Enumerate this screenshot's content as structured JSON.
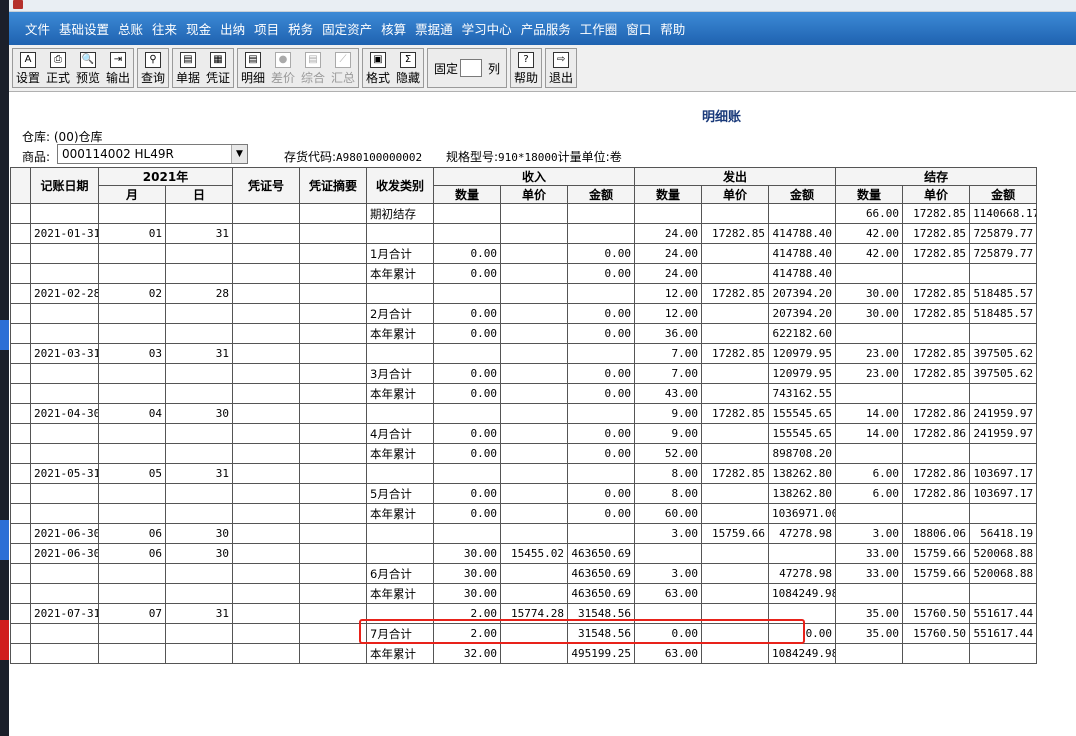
{
  "menu": [
    "文件",
    "基础设置",
    "总账",
    "往来",
    "现金",
    "出纳",
    "项目",
    "税务",
    "固定资产",
    "核算",
    "票据通",
    "学习中心",
    "产品服务",
    "工作圈",
    "窗口",
    "帮助"
  ],
  "toolbar": {
    "groups": [
      [
        {
          "label": "设置",
          "icon": "A"
        },
        {
          "label": "正式",
          "icon": "⎙"
        },
        {
          "label": "预览",
          "icon": "🔍"
        },
        {
          "label": "输出",
          "icon": "⇥"
        }
      ],
      [
        {
          "label": "查询",
          "icon": "⚲"
        }
      ],
      [
        {
          "label": "单据",
          "icon": "▤"
        },
        {
          "label": "凭证",
          "icon": "▦"
        }
      ],
      [
        {
          "label": "明细",
          "icon": "▤"
        },
        {
          "label": "差价",
          "icon": "●",
          "disabled": true
        },
        {
          "label": "综合",
          "icon": "▤",
          "disabled": true
        },
        {
          "label": "汇总",
          "icon": "⟋",
          "disabled": true
        }
      ],
      [
        {
          "label": "格式",
          "icon": "▣"
        },
        {
          "label": "隐藏",
          "icon": "Σ"
        }
      ]
    ],
    "fixed_label": "固定",
    "column_label": "列",
    "help": {
      "label": "帮助",
      "icon": "?"
    },
    "exit": {
      "label": "退出",
      "icon": "⇨"
    }
  },
  "report": {
    "title": "明细账",
    "warehouse_label": "仓库:",
    "warehouse_value": "(00)仓库",
    "goods_label": "商品:",
    "goods_value": "000114002 HL49R",
    "stock_code_label": "存货代码:",
    "stock_code_value": "A980100000002",
    "spec_label": "规格型号:",
    "spec_value": "910*18000",
    "unit_label": "计量单位:",
    "unit_value": "卷"
  },
  "table": {
    "headers": {
      "date": "记账日期",
      "year": "2021年",
      "month": "月",
      "day": "日",
      "voucher_no": "凭证号",
      "voucher_summary": "凭证摘要",
      "category": "收发类别",
      "in": "收入",
      "out": "发出",
      "balance": "结存",
      "qty": "数量",
      "price": "单价",
      "amount": "金额"
    },
    "rows": [
      {
        "date": "",
        "m": "",
        "d": "",
        "cat": "期初结存",
        "in_q": "",
        "in_p": "",
        "in_a": "",
        "out_q": "",
        "out_p": "",
        "out_a": "",
        "b_q": "66.00",
        "b_p": "17282.85",
        "b_a": "1140668.17"
      },
      {
        "date": "2021-01-31",
        "m": "01",
        "d": "31",
        "cat": "",
        "in_q": "",
        "in_p": "",
        "in_a": "",
        "out_q": "24.00",
        "out_p": "17282.85",
        "out_a": "414788.40",
        "b_q": "42.00",
        "b_p": "17282.85",
        "b_a": "725879.77"
      },
      {
        "date": "",
        "m": "",
        "d": "",
        "cat": "1月合计",
        "in_q": "0.00",
        "in_p": "",
        "in_a": "0.00",
        "out_q": "24.00",
        "out_p": "",
        "out_a": "414788.40",
        "b_q": "42.00",
        "b_p": "17282.85",
        "b_a": "725879.77"
      },
      {
        "date": "",
        "m": "",
        "d": "",
        "cat": "本年累计",
        "in_q": "0.00",
        "in_p": "",
        "in_a": "0.00",
        "out_q": "24.00",
        "out_p": "",
        "out_a": "414788.40",
        "b_q": "",
        "b_p": "",
        "b_a": ""
      },
      {
        "date": "2021-02-28",
        "m": "02",
        "d": "28",
        "cat": "",
        "in_q": "",
        "in_p": "",
        "in_a": "",
        "out_q": "12.00",
        "out_p": "17282.85",
        "out_a": "207394.20",
        "b_q": "30.00",
        "b_p": "17282.85",
        "b_a": "518485.57"
      },
      {
        "date": "",
        "m": "",
        "d": "",
        "cat": "2月合计",
        "in_q": "0.00",
        "in_p": "",
        "in_a": "0.00",
        "out_q": "12.00",
        "out_p": "",
        "out_a": "207394.20",
        "b_q": "30.00",
        "b_p": "17282.85",
        "b_a": "518485.57"
      },
      {
        "date": "",
        "m": "",
        "d": "",
        "cat": "本年累计",
        "in_q": "0.00",
        "in_p": "",
        "in_a": "0.00",
        "out_q": "36.00",
        "out_p": "",
        "out_a": "622182.60",
        "b_q": "",
        "b_p": "",
        "b_a": ""
      },
      {
        "date": "2021-03-31",
        "m": "03",
        "d": "31",
        "cat": "",
        "in_q": "",
        "in_p": "",
        "in_a": "",
        "out_q": "7.00",
        "out_p": "17282.85",
        "out_a": "120979.95",
        "b_q": "23.00",
        "b_p": "17282.85",
        "b_a": "397505.62"
      },
      {
        "date": "",
        "m": "",
        "d": "",
        "cat": "3月合计",
        "in_q": "0.00",
        "in_p": "",
        "in_a": "0.00",
        "out_q": "7.00",
        "out_p": "",
        "out_a": "120979.95",
        "b_q": "23.00",
        "b_p": "17282.85",
        "b_a": "397505.62"
      },
      {
        "date": "",
        "m": "",
        "d": "",
        "cat": "本年累计",
        "in_q": "0.00",
        "in_p": "",
        "in_a": "0.00",
        "out_q": "43.00",
        "out_p": "",
        "out_a": "743162.55",
        "b_q": "",
        "b_p": "",
        "b_a": ""
      },
      {
        "date": "2021-04-30",
        "m": "04",
        "d": "30",
        "cat": "",
        "in_q": "",
        "in_p": "",
        "in_a": "",
        "out_q": "9.00",
        "out_p": "17282.85",
        "out_a": "155545.65",
        "b_q": "14.00",
        "b_p": "17282.86",
        "b_a": "241959.97"
      },
      {
        "date": "",
        "m": "",
        "d": "",
        "cat": "4月合计",
        "in_q": "0.00",
        "in_p": "",
        "in_a": "0.00",
        "out_q": "9.00",
        "out_p": "",
        "out_a": "155545.65",
        "b_q": "14.00",
        "b_p": "17282.86",
        "b_a": "241959.97"
      },
      {
        "date": "",
        "m": "",
        "d": "",
        "cat": "本年累计",
        "in_q": "0.00",
        "in_p": "",
        "in_a": "0.00",
        "out_q": "52.00",
        "out_p": "",
        "out_a": "898708.20",
        "b_q": "",
        "b_p": "",
        "b_a": ""
      },
      {
        "date": "2021-05-31",
        "m": "05",
        "d": "31",
        "cat": "",
        "in_q": "",
        "in_p": "",
        "in_a": "",
        "out_q": "8.00",
        "out_p": "17282.85",
        "out_a": "138262.80",
        "b_q": "6.00",
        "b_p": "17282.86",
        "b_a": "103697.17"
      },
      {
        "date": "",
        "m": "",
        "d": "",
        "cat": "5月合计",
        "in_q": "0.00",
        "in_p": "",
        "in_a": "0.00",
        "out_q": "8.00",
        "out_p": "",
        "out_a": "138262.80",
        "b_q": "6.00",
        "b_p": "17282.86",
        "b_a": "103697.17"
      },
      {
        "date": "",
        "m": "",
        "d": "",
        "cat": "本年累计",
        "in_q": "0.00",
        "in_p": "",
        "in_a": "0.00",
        "out_q": "60.00",
        "out_p": "",
        "out_a": "1036971.00",
        "b_q": "",
        "b_p": "",
        "b_a": ""
      },
      {
        "date": "2021-06-30",
        "m": "06",
        "d": "30",
        "cat": "",
        "in_q": "",
        "in_p": "",
        "in_a": "",
        "out_q": "3.00",
        "out_p": "15759.66",
        "out_a": "47278.98",
        "b_q": "3.00",
        "b_p": "18806.06",
        "b_a": "56418.19"
      },
      {
        "date": "2021-06-30",
        "m": "06",
        "d": "30",
        "cat": "",
        "in_q": "30.00",
        "in_p": "15455.02",
        "in_a": "463650.69",
        "out_q": "",
        "out_p": "",
        "out_a": "",
        "b_q": "33.00",
        "b_p": "15759.66",
        "b_a": "520068.88"
      },
      {
        "date": "",
        "m": "",
        "d": "",
        "cat": "6月合计",
        "in_q": "30.00",
        "in_p": "",
        "in_a": "463650.69",
        "out_q": "3.00",
        "out_p": "",
        "out_a": "47278.98",
        "b_q": "33.00",
        "b_p": "15759.66",
        "b_a": "520068.88"
      },
      {
        "date": "",
        "m": "",
        "d": "",
        "cat": "本年累计",
        "in_q": "30.00",
        "in_p": "",
        "in_a": "463650.69",
        "out_q": "63.00",
        "out_p": "",
        "out_a": "1084249.98",
        "b_q": "",
        "b_p": "",
        "b_a": ""
      },
      {
        "date": "2021-07-31",
        "m": "07",
        "d": "31",
        "cat": "",
        "in_q": "2.00",
        "in_p": "15774.28",
        "in_a": "31548.56",
        "out_q": "",
        "out_p": "",
        "out_a": "",
        "b_q": "35.00",
        "b_p": "15760.50",
        "b_a": "551617.44"
      },
      {
        "date": "",
        "m": "",
        "d": "",
        "cat": "7月合计",
        "in_q": "2.00",
        "in_p": "",
        "in_a": "31548.56",
        "out_q": "0.00",
        "out_p": "",
        "out_a": "0.00",
        "b_q": "35.00",
        "b_p": "15760.50",
        "b_a": "551617.44"
      },
      {
        "date": "",
        "m": "",
        "d": "",
        "cat": "本年累计",
        "in_q": "32.00",
        "in_p": "",
        "in_a": "495199.25",
        "out_q": "63.00",
        "out_p": "",
        "out_a": "1084249.98",
        "b_q": "",
        "b_p": "",
        "b_a": ""
      }
    ]
  },
  "colors": {
    "menubar": "#1f62b0",
    "highlight": "#e8221a",
    "title": "#1a3a7a"
  }
}
